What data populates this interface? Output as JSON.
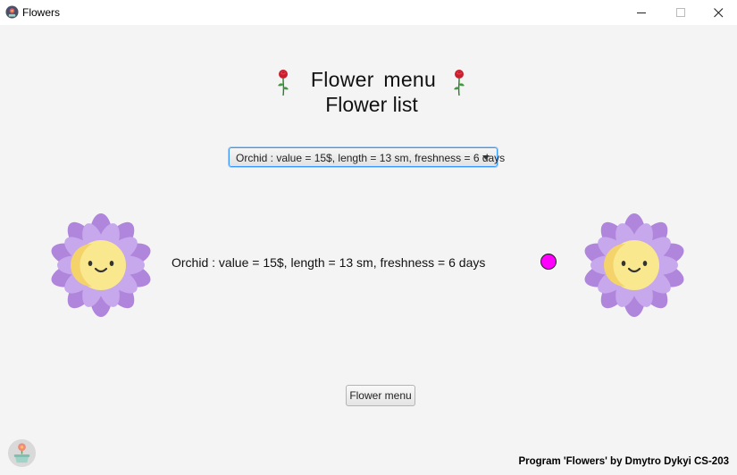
{
  "window": {
    "title": "Flowers",
    "icons": {
      "app": "flower-app-icon",
      "minimize": "minimize-icon",
      "maximize": "maximize-icon",
      "close": "close-icon"
    }
  },
  "header": {
    "title": "Flower  menu",
    "subtitle": "Flower list",
    "decoration_icon": "rose-icon"
  },
  "selector": {
    "selected": "Orchid : value = 15$, length = 13 sm, freshness = 6 days",
    "dropdown_icon": "dropdown-arrow-icon"
  },
  "main": {
    "flower_icon": "smiling-flower-icon",
    "description": "Orchid : value = 15$, length = 13 sm, freshness = 6 days",
    "indicator_color": "#ff00ff"
  },
  "actions": {
    "menu_button_label": "Flower menu"
  },
  "footer": {
    "credit": "Program 'Flowers' by Dmytro Dykyi CS-203",
    "logo_icon": "flower-pot-logo-icon"
  },
  "colors": {
    "focus_border": "#3b99fc",
    "petal": "#b085dc",
    "petal_light": "#c7a8ec",
    "face": "#f9e88e"
  }
}
